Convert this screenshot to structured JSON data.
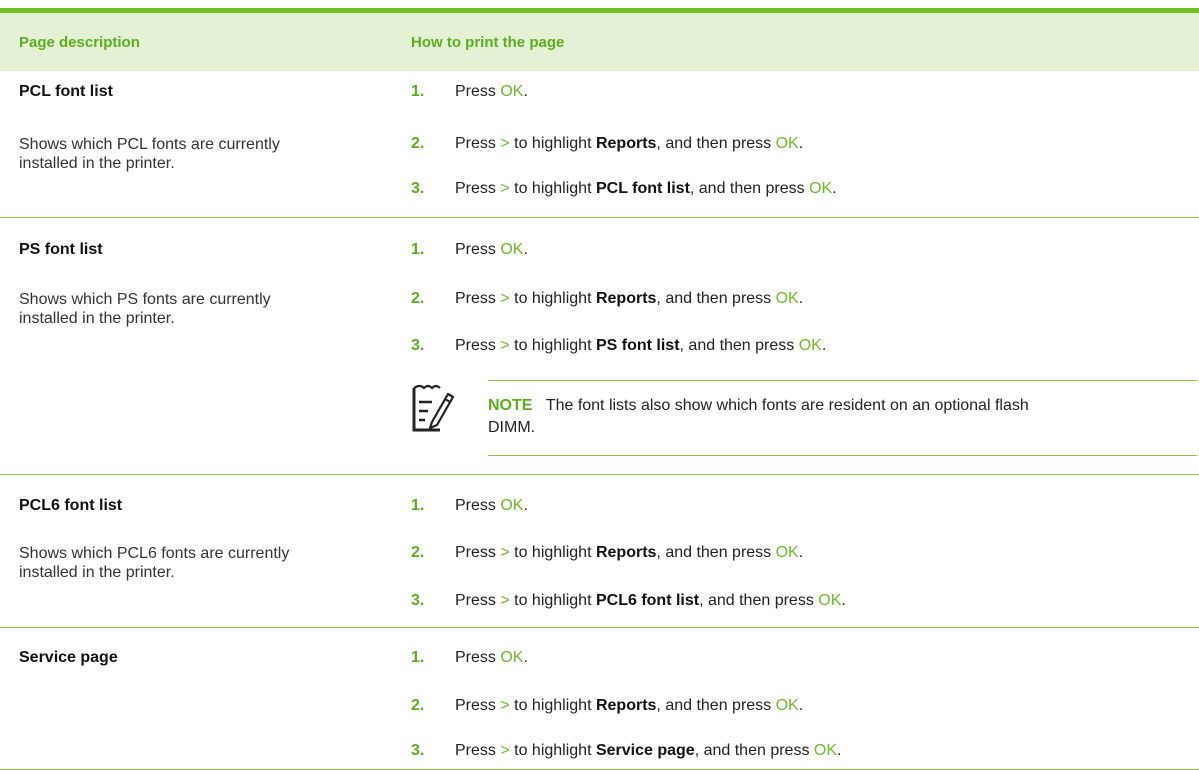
{
  "header": {
    "col1": "Page description",
    "col2": "How to print the page"
  },
  "rows": [
    {
      "title": "PCL font list",
      "desc_line1": "Shows which PCL fonts are currently",
      "desc_line2": "installed in the printer.",
      "steps": [
        {
          "num": "1.",
          "a": "Press ",
          "ok": "OK",
          "z": "."
        },
        {
          "num": "2.",
          "a": "Press ",
          "arrow": ">",
          "b": " to highlight ",
          "item": "Reports",
          "c": ", and then press ",
          "ok": "OK",
          "z": "."
        },
        {
          "num": "3.",
          "a": "Press ",
          "arrow": ">",
          "b": " to highlight ",
          "item": "PCL font list",
          "c": ", and then press ",
          "ok": "OK",
          "z": "."
        }
      ]
    },
    {
      "title": "PS font list",
      "desc_line1": "Shows which PS fonts are currently",
      "desc_line2": "installed in the printer.",
      "steps": [
        {
          "num": "1.",
          "a": "Press ",
          "ok": "OK",
          "z": "."
        },
        {
          "num": "2.",
          "a": "Press ",
          "arrow": ">",
          "b": " to highlight ",
          "item": "Reports",
          "c": ", and then press ",
          "ok": "OK",
          "z": "."
        },
        {
          "num": "3.",
          "a": "Press ",
          "arrow": ">",
          "b": " to highlight ",
          "item": "PS font list",
          "c": ", and then press ",
          "ok": "OK",
          "z": "."
        }
      ],
      "note": {
        "label": "NOTE",
        "line1": "The font lists also show which fonts are resident on an optional flash",
        "line2": "DIMM."
      }
    },
    {
      "title": "PCL6 font list",
      "desc_line1": "Shows which PCL6 fonts are currently",
      "desc_line2": "installed in the printer.",
      "steps": [
        {
          "num": "1.",
          "a": "Press ",
          "ok": "OK",
          "z": "."
        },
        {
          "num": "2.",
          "a": "Press ",
          "arrow": ">",
          "b": " to highlight ",
          "item": "Reports",
          "c": ", and then press ",
          "ok": "OK",
          "z": "."
        },
        {
          "num": "3.",
          "a": "Press ",
          "arrow": ">",
          "b": " to highlight ",
          "item": "PCL6 font list",
          "c": ", and then press ",
          "ok": "OK",
          "z": "."
        }
      ]
    },
    {
      "title": "Service page",
      "steps": [
        {
          "num": "1.",
          "a": "Press ",
          "ok": "OK",
          "z": "."
        },
        {
          "num": "2.",
          "a": "Press ",
          "arrow": ">",
          "b": " to highlight ",
          "item": "Reports",
          "c": ", and then press ",
          "ok": "OK",
          "z": "."
        },
        {
          "num": "3.",
          "a": "Press ",
          "arrow": ">",
          "b": " to highlight ",
          "item": "Service page",
          "c": ", and then press ",
          "ok": "OK",
          "z": "."
        }
      ]
    }
  ],
  "icons": {
    "note": "note-pencil-icon"
  },
  "colors": {
    "accent_green": "#6cbd26",
    "header_bg": "#e4f1d4",
    "rule": "#8cc63f"
  }
}
